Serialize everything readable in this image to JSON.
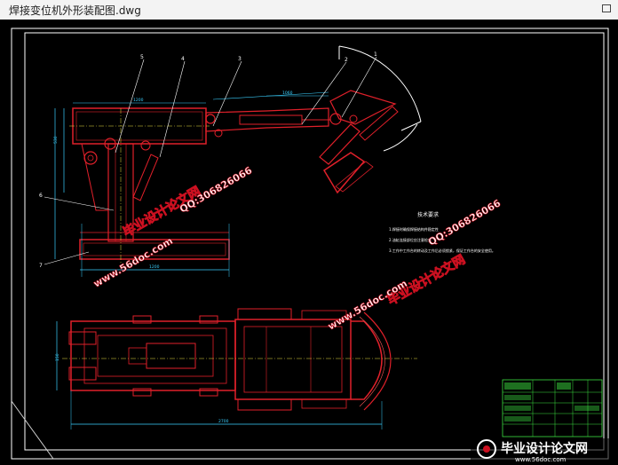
{
  "window": {
    "title": "焊接变位机外形装配图.dwg"
  },
  "drawing": {
    "part_labels": [
      "5",
      "4",
      "3",
      "2",
      "1",
      "6",
      "7"
    ],
    "dimensions": {
      "top_width": "1200",
      "top_height": "530",
      "top_right": "1060",
      "base_width": "1200",
      "plan_left": "150",
      "plan_bottom": "2700"
    },
    "notes_title": "技术要求",
    "notes": [
      "1.焊接时确保焊接结构件稳定性",
      "2.油缸连接部位应注意检查",
      "3.工作中工作台的转动及工作后必须锁紧，保证工作台的安全使用。"
    ]
  },
  "watermarks": {
    "brand": "毕业设计论文网",
    "site": "www.56doc.com",
    "qq": "QQ:306826066"
  },
  "footer_logo": {
    "brand": "毕业设计论文网",
    "site": "www.56doc.com"
  },
  "colors": {
    "frame": "#ffffff",
    "part": "#e0202a",
    "dim": "#3ad0ff",
    "center": "#e8e040",
    "hatch": "#ff5a5a",
    "title_block": "#3ce040"
  }
}
